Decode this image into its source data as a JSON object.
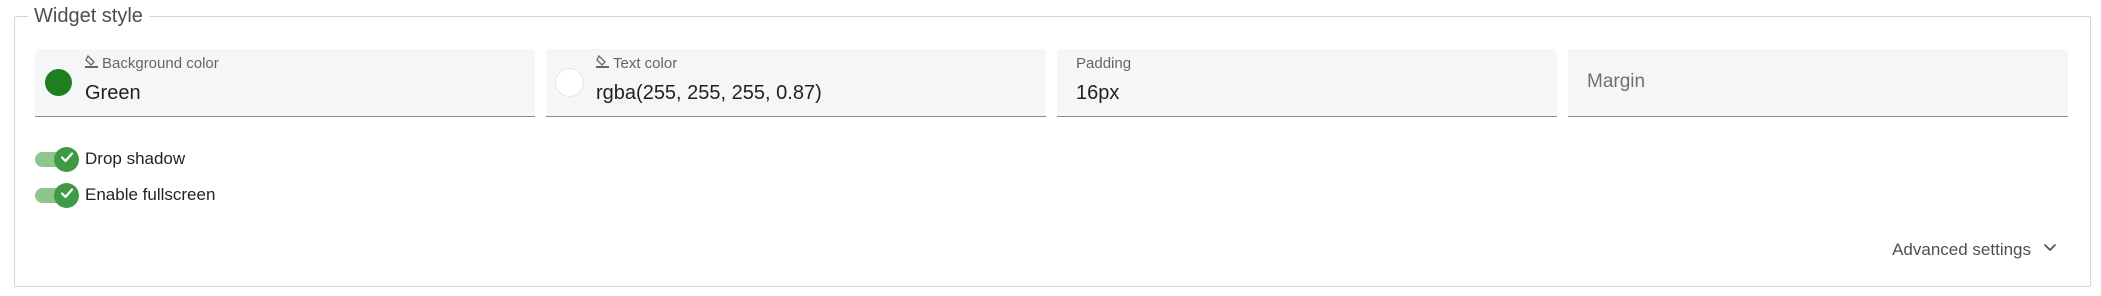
{
  "section": {
    "title": "Widget style"
  },
  "fields": {
    "background_color": {
      "label": "Background color",
      "value": "Green",
      "swatch_color": "#1f7f1f",
      "icon": "format-color-fill-icon"
    },
    "text_color": {
      "label": "Text color",
      "value": "rgba(255, 255, 255, 0.87)",
      "swatch_color": "#ffffff",
      "icon": "format-color-text-icon"
    },
    "padding": {
      "label": "Padding",
      "value": "16px"
    },
    "margin": {
      "placeholder": "Margin"
    }
  },
  "toggles": [
    {
      "label": "Drop shadow",
      "checked": true
    },
    {
      "label": "Enable fullscreen",
      "checked": true
    }
  ],
  "advanced": {
    "label": "Advanced settings",
    "icon": "chevron-down-icon"
  },
  "colors": {
    "accent": "#3f9a45",
    "accent_track": "#8dc58d"
  }
}
